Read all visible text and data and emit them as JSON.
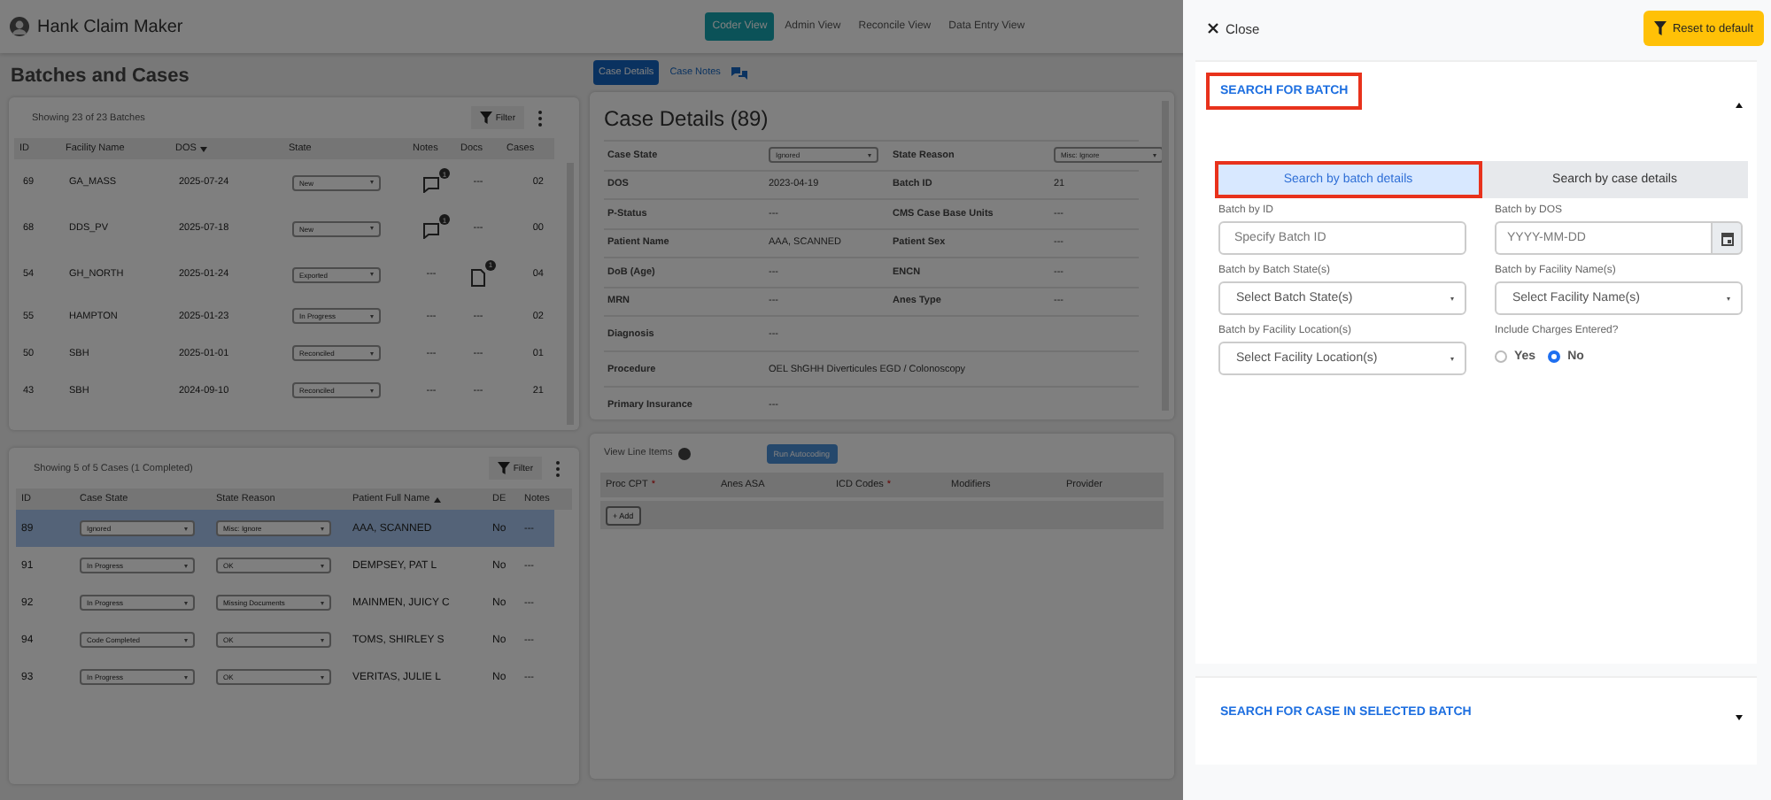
{
  "app": {
    "title": "Hank Claim Maker",
    "nav": [
      {
        "label": "Coder View",
        "selected": true
      },
      {
        "label": "Admin View",
        "selected": false
      },
      {
        "label": "Reconcile View",
        "selected": false
      },
      {
        "label": "Data Entry View",
        "selected": false
      }
    ],
    "page_title": "Batches and Cases",
    "batches": {
      "summary": "Showing 23 of 23 Batches",
      "filter_label": "Filter",
      "columns": [
        {
          "label": "ID"
        },
        {
          "label": "Facility Name"
        },
        {
          "label": "DOS",
          "sort_ascending": false
        },
        {
          "label": "State"
        },
        {
          "label": "Notes"
        },
        {
          "label": "Docs"
        },
        {
          "label": "Cases"
        }
      ],
      "rows": [
        {
          "id": "69",
          "facility": "GA_MASS",
          "dos": "2025-07-24",
          "state": "New",
          "notes": {
            "kind": "badge",
            "count": "1"
          },
          "docs": {
            "kind": "text",
            "text": "---"
          },
          "cases": "02"
        },
        {
          "id": "68",
          "facility": "DDS_PV",
          "dos": "2025-07-18",
          "state": "New",
          "notes": {
            "kind": "badge",
            "count": "1"
          },
          "docs": {
            "kind": "text",
            "text": "---"
          },
          "cases": "00"
        },
        {
          "id": "54",
          "facility": "GH_NORTH",
          "dos": "2025-01-24",
          "state": "Exported",
          "notes": {
            "kind": "text",
            "text": "---"
          },
          "docs": {
            "kind": "badge",
            "count": "1"
          },
          "cases": "04"
        },
        {
          "id": "55",
          "facility": "HAMPTON",
          "dos": "2025-01-23",
          "state": "In Progress",
          "notes": {
            "kind": "text",
            "text": "---"
          },
          "docs": {
            "kind": "text",
            "text": "---"
          },
          "cases": "02"
        },
        {
          "id": "50",
          "facility": "SBH",
          "dos": "2025-01-01",
          "state": "Reconciled",
          "notes": {
            "kind": "text",
            "text": "---"
          },
          "docs": {
            "kind": "text",
            "text": "---"
          },
          "cases": "01"
        },
        {
          "id": "43",
          "facility": "SBH",
          "dos": "2024-09-10",
          "state": "Reconciled",
          "notes": {
            "kind": "text",
            "text": "---"
          },
          "docs": {
            "kind": "text",
            "text": "---"
          },
          "cases": "21"
        }
      ]
    },
    "cases": {
      "summary": "Showing 5 of 5 Cases (1 Completed)",
      "filter_label": "Filter",
      "columns": [
        {
          "label": "ID"
        },
        {
          "label": "Case State"
        },
        {
          "label": "State Reason"
        },
        {
          "label": "Patient Full Name",
          "sort_ascending": true
        },
        {
          "label": "DE"
        },
        {
          "label": "Notes"
        }
      ],
      "rows": [
        {
          "id": "89",
          "state": "Ignored",
          "reason": "Misc: Ignore",
          "patient": "AAA, SCANNED",
          "de": "No",
          "notes": "---",
          "selected": true
        },
        {
          "id": "91",
          "state": "In Progress",
          "reason": "OK",
          "patient": "DEMPSEY, PAT L",
          "de": "No",
          "notes": "---",
          "selected": false
        },
        {
          "id": "92",
          "state": "In Progress",
          "reason": "Missing Documents",
          "patient": "MAINMEN, JUICY C",
          "de": "No",
          "notes": "---",
          "selected": false
        },
        {
          "id": "94",
          "state": "Code Completed",
          "reason": "OK",
          "patient": "TOMS, SHIRLEY S",
          "de": "No",
          "notes": "---",
          "selected": false
        },
        {
          "id": "93",
          "state": "In Progress",
          "reason": "OK",
          "patient": "VERITAS, JULIE L",
          "de": "No",
          "notes": "---",
          "selected": false
        }
      ]
    },
    "detail_tabs": [
      {
        "label": "Case Details",
        "selected": true
      },
      {
        "label": "Case Notes",
        "selected": false
      }
    ],
    "details": {
      "title": "Case Details (89)",
      "rows": [
        [
          {
            "label": "Case State",
            "value": "Ignored",
            "kind": "select"
          },
          {
            "label": "State Reason",
            "value": "Misc: Ignore",
            "kind": "select"
          }
        ],
        [
          {
            "label": "DOS",
            "value": "2023-04-19",
            "kind": "text"
          },
          {
            "label": "Batch ID",
            "value": "21",
            "kind": "text"
          }
        ],
        [
          {
            "label": "P-Status",
            "value": "---",
            "kind": "text"
          },
          {
            "label": "CMS Case Base Units",
            "value": "---",
            "kind": "text"
          }
        ],
        [
          {
            "label": "Patient Name",
            "value": "AAA, SCANNED",
            "kind": "text"
          },
          {
            "label": "Patient Sex",
            "value": "---",
            "kind": "text"
          }
        ],
        [
          {
            "label": "DoB (Age)",
            "value": "---",
            "kind": "text"
          },
          {
            "label": "ENCN",
            "value": "---",
            "kind": "text"
          }
        ],
        [
          {
            "label": "MRN",
            "value": "---",
            "kind": "text"
          },
          {
            "label": "Anes Type",
            "value": "---",
            "kind": "text"
          }
        ],
        [
          {
            "label": "Diagnosis",
            "value": "---",
            "kind": "text"
          }
        ],
        [
          {
            "label": "Procedure",
            "value": "OEL ShGHH Diverticules EGD / Colonoscopy",
            "kind": "text"
          }
        ],
        [
          {
            "label": "Primary Insurance",
            "value": "---",
            "kind": "text"
          }
        ]
      ]
    },
    "line_items": {
      "title": "View Line Items",
      "autocode_label": "Run Autocoding",
      "columns": [
        {
          "label": "Proc CPT",
          "mark": "*"
        },
        {
          "label": "Anes ASA"
        },
        {
          "label": "ICD Codes",
          "mark": "*"
        },
        {
          "label": "Modifiers"
        },
        {
          "label": "Provider"
        }
      ],
      "add_label": "+ Add"
    }
  },
  "drawer": {
    "close_label": "Close",
    "reset_label": "Reset to default",
    "sections": [
      {
        "title": "SEARCH FOR BATCH",
        "expanded": true,
        "highlighted": true,
        "tabs": [
          {
            "label": "Search by batch details",
            "selected": true,
            "highlighted": true
          },
          {
            "label": "Search by case details",
            "selected": false,
            "highlighted": false
          }
        ],
        "fields": [
          {
            "kind": "input",
            "label": "Batch by ID",
            "placeholder": "Specify Batch ID"
          },
          {
            "kind": "date",
            "label": "Batch by DOS",
            "placeholder": "YYYY-MM-DD"
          },
          {
            "kind": "select",
            "label": "Batch by Batch State(s)",
            "placeholder": "Select Batch State(s)"
          },
          {
            "kind": "select",
            "label": "Batch by Facility Name(s)",
            "placeholder": "Select Facility Name(s)"
          },
          {
            "kind": "select",
            "label": "Batch by Facility Location(s)",
            "placeholder": "Select Facility Location(s)"
          },
          {
            "kind": "radio",
            "label": "Include Charges Entered?",
            "options": [
              {
                "label": "Yes",
                "selected": false
              },
              {
                "label": "No",
                "selected": true
              }
            ]
          }
        ]
      },
      {
        "title": "SEARCH FOR CASE IN SELECTED BATCH",
        "expanded": false,
        "highlighted": false
      }
    ]
  }
}
